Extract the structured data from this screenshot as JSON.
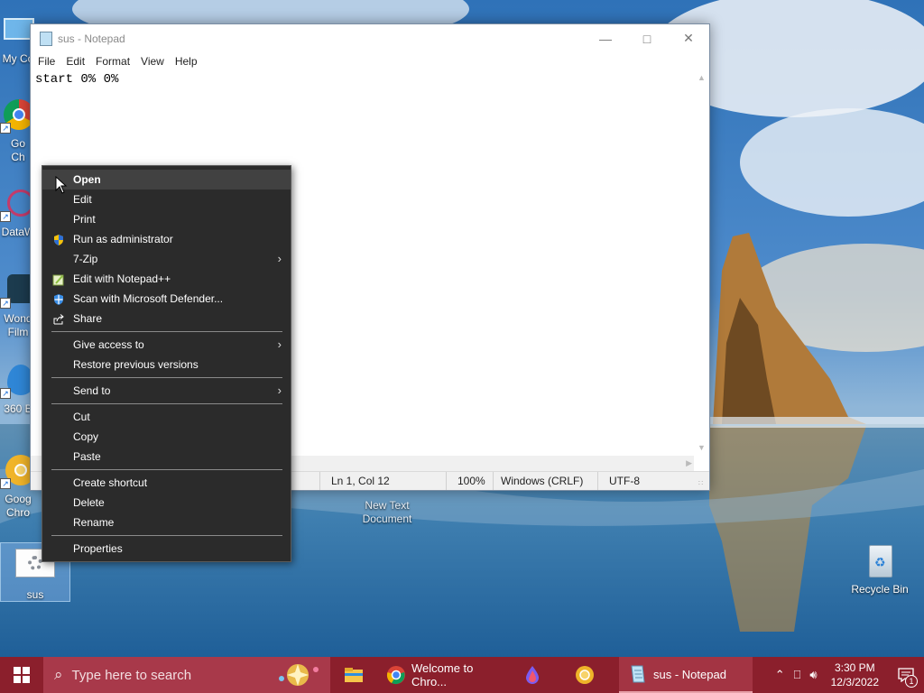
{
  "colors": {
    "taskbar": "#8b1f2c",
    "search_box": "#a8394a",
    "context_menu_bg": "#2b2b2b",
    "context_menu_highlight": "#414141"
  },
  "notepad": {
    "title": "sus - Notepad",
    "menu": [
      "File",
      "Edit",
      "Format",
      "View",
      "Help"
    ],
    "content": "start 0% 0%",
    "status": {
      "position": "Ln 1, Col 12",
      "zoom": "100%",
      "line_endings": "Windows (CRLF)",
      "encoding": "UTF-8"
    }
  },
  "context_menu": {
    "groups": [
      [
        {
          "label": "Open",
          "icon": "",
          "highlighted": true
        },
        {
          "label": "Edit",
          "icon": ""
        },
        {
          "label": "Print",
          "icon": ""
        },
        {
          "label": "Run as administrator",
          "icon": "uac-shield-icon"
        },
        {
          "label": "7-Zip",
          "icon": "",
          "submenu": true
        },
        {
          "label": "Edit with Notepad++",
          "icon": "notepad-plus-plus-icon"
        },
        {
          "label": "Scan with Microsoft Defender...",
          "icon": "defender-icon"
        },
        {
          "label": "Share",
          "icon": "share-icon"
        }
      ],
      [
        {
          "label": "Give access to",
          "icon": "",
          "submenu": true
        },
        {
          "label": "Restore previous versions",
          "icon": ""
        }
      ],
      [
        {
          "label": "Send to",
          "icon": "",
          "submenu": true
        }
      ],
      [
        {
          "label": "Cut",
          "icon": ""
        },
        {
          "label": "Copy",
          "icon": ""
        },
        {
          "label": "Paste",
          "icon": ""
        }
      ],
      [
        {
          "label": "Create shortcut",
          "icon": ""
        },
        {
          "label": "Delete",
          "icon": ""
        },
        {
          "label": "Rename",
          "icon": ""
        }
      ],
      [
        {
          "label": "Properties",
          "icon": ""
        }
      ]
    ]
  },
  "desktop": {
    "icons_left": [
      {
        "label": "My Co",
        "icon": "computer-icon"
      },
      {
        "label": "Go\nCh",
        "icon": "chrome-icon"
      },
      {
        "label": "DataW",
        "icon": "datawrapper-icon"
      },
      {
        "label": "Wond\nFilm",
        "icon": "filmora-icon"
      },
      {
        "label": "360 B",
        "icon": "360-browser-icon"
      },
      {
        "label": "Goog\nChro",
        "icon": "chrome-canary-icon"
      }
    ],
    "selected_file": {
      "label": "sus",
      "icon": "settings-file-icon"
    },
    "new_text_document": "New Text\nDocument",
    "recycle_bin": "Recycle Bin"
  },
  "taskbar": {
    "search_placeholder": "Type here to search",
    "apps": [
      {
        "label": "",
        "icon": "file-explorer-icon"
      },
      {
        "label": "Welcome to Chro...",
        "icon": "chrome-icon"
      },
      {
        "label": "",
        "icon": "paint-drop-icon"
      },
      {
        "label": "",
        "icon": "chrome-canary-icon"
      },
      {
        "label": "sus - Notepad",
        "icon": "notepad-icon",
        "active": true
      }
    ],
    "time": "3:30 PM",
    "date": "12/3/2022",
    "notification_count": "1"
  }
}
